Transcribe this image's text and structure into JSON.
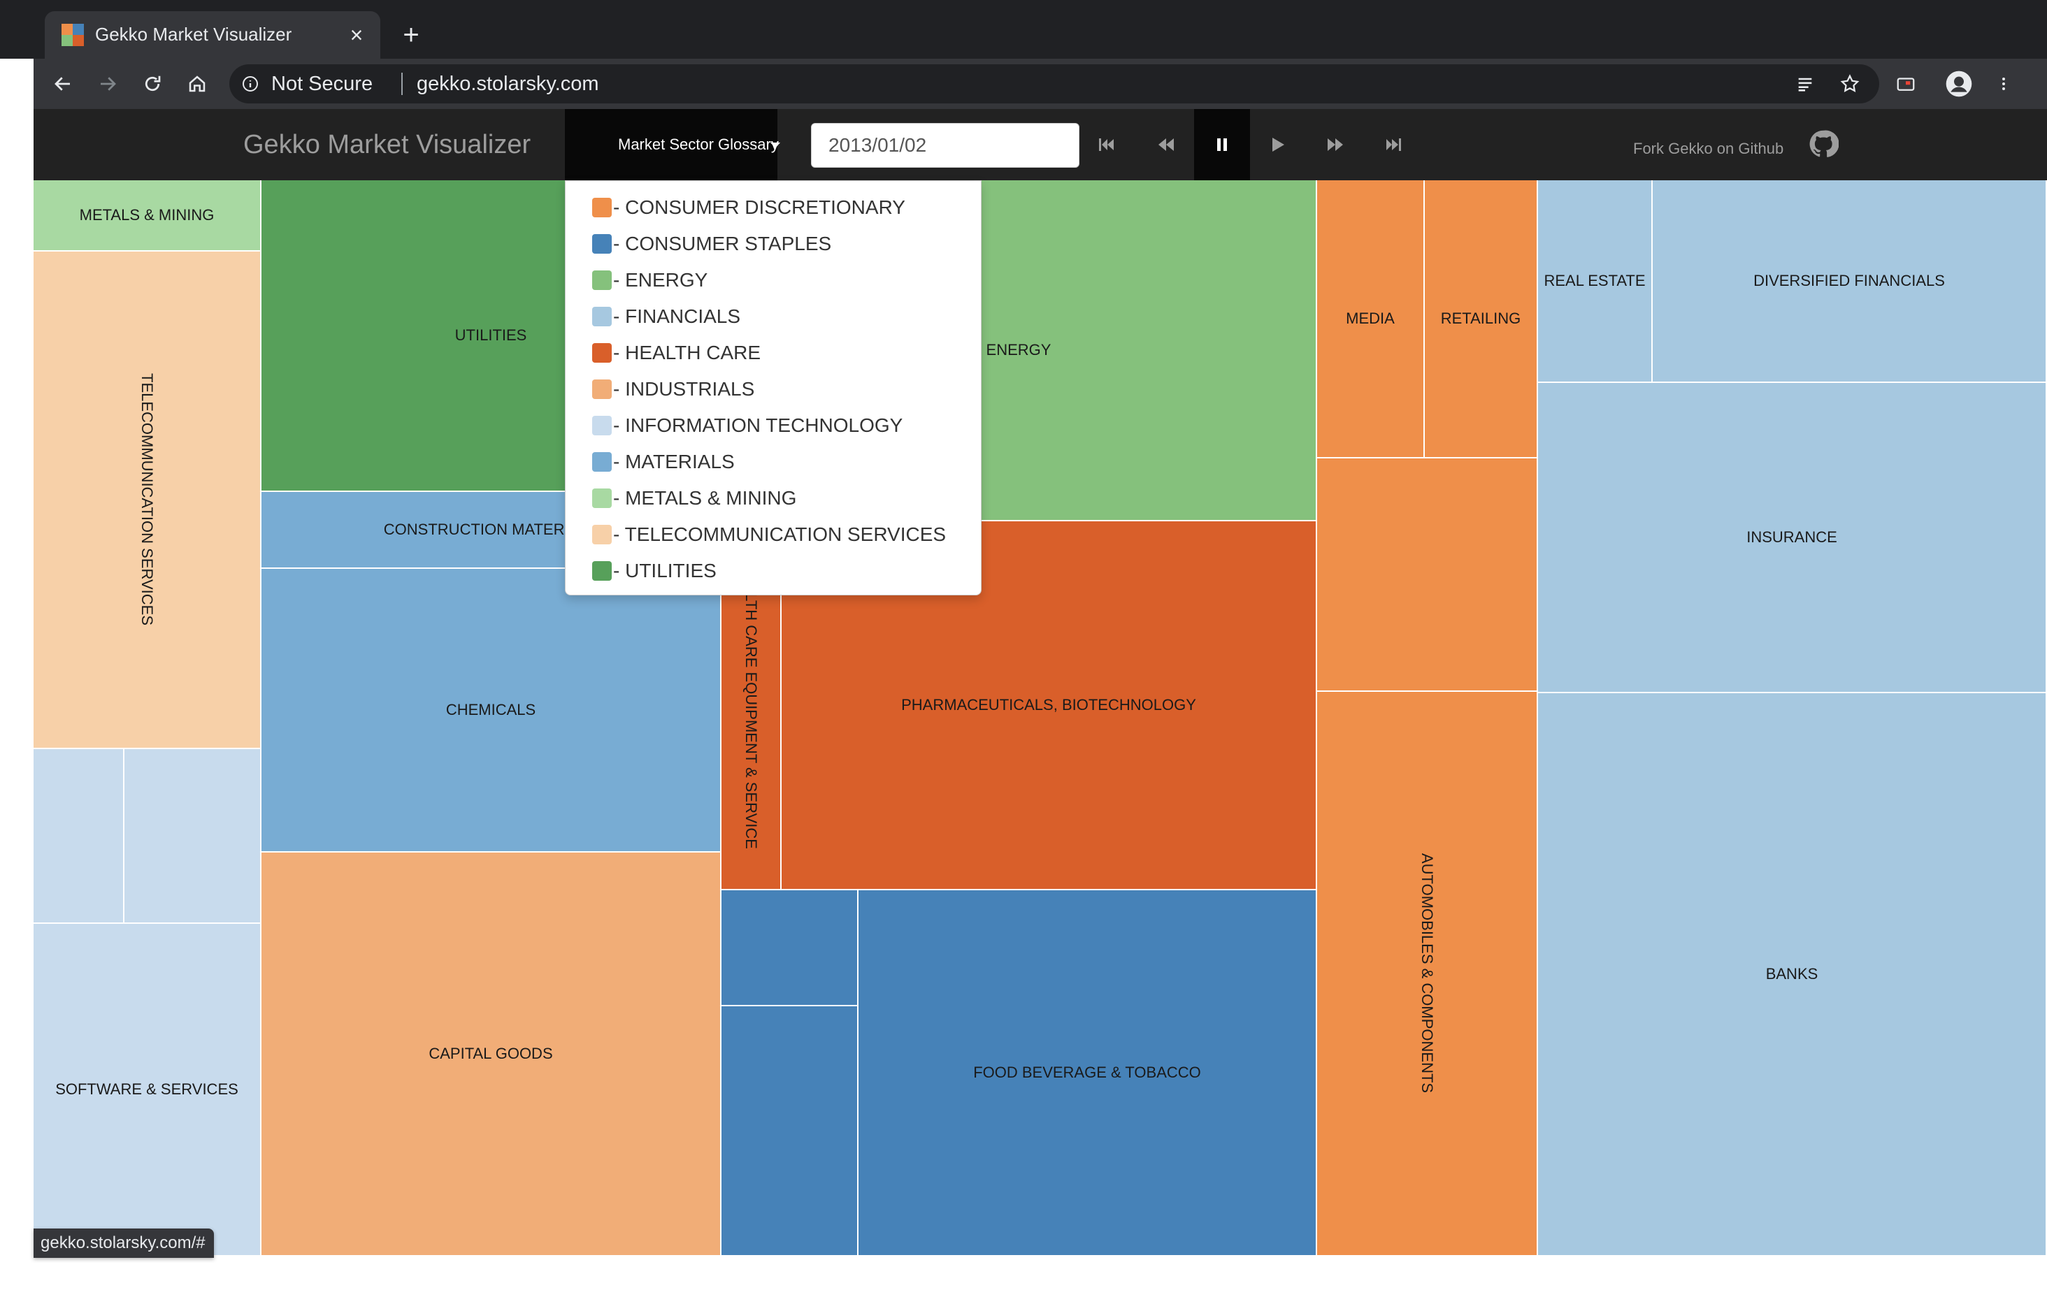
{
  "browser": {
    "tab_title": "Gekko Market Visualizer",
    "address": {
      "security_label": "Not Secure",
      "url": "gekko.stolarsky.com"
    },
    "status_url": "gekko.stolarsky.com/#"
  },
  "navbar": {
    "brand": "Gekko Market Visualizer",
    "glossary_button": "Market Sector Glossary",
    "date_value": "2013/01/02",
    "playback": [
      "jump-to-start",
      "step-back",
      "pause",
      "play",
      "step-forward",
      "jump-to-end"
    ],
    "active_control": "pause",
    "fork_link": "Fork Gekko on Github"
  },
  "glossary": [
    {
      "label": "- CONSUMER DISCRETIONARY",
      "color": "#ef8f4a"
    },
    {
      "label": "- CONSUMER STAPLES",
      "color": "#4682b8"
    },
    {
      "label": "- ENERGY",
      "color": "#85c17c"
    },
    {
      "label": "- FINANCIALS",
      "color": "#a6c8e0"
    },
    {
      "label": "- HEALTH CARE",
      "color": "#d95f2a"
    },
    {
      "label": "- INDUSTRIALS",
      "color": "#f1ad77"
    },
    {
      "label": "- INFORMATION TECHNOLOGY",
      "color": "#c8dbed"
    },
    {
      "label": "- MATERIALS",
      "color": "#78acd3"
    },
    {
      "label": "- METALS & MINING",
      "color": "#a8d9a2"
    },
    {
      "label": "- TELECOMMUNICATION SERVICES",
      "color": "#f7d0a8"
    },
    {
      "label": "- UTILITIES",
      "color": "#57a05a"
    }
  ],
  "treemap": {
    "cells": [
      {
        "id": "metals-mining",
        "label": "METALS & MINING",
        "sector": "METALS & MINING",
        "color": "#a8d9a2"
      },
      {
        "id": "telecom",
        "label": "TELECOMMUNICATION SERVICES",
        "sector": "TELECOMMUNICATION SERVICES",
        "color": "#f7d0a8"
      },
      {
        "id": "it-a",
        "label": "",
        "sector": "INFORMATION TECHNOLOGY",
        "color": "#c8dbed"
      },
      {
        "id": "it-b",
        "label": "",
        "sector": "INFORMATION TECHNOLOGY",
        "color": "#c8dbed"
      },
      {
        "id": "software",
        "label": "SOFTWARE & SERVICES",
        "sector": "INFORMATION TECHNOLOGY",
        "color": "#c8dbed"
      },
      {
        "id": "utilities",
        "label": "UTILITIES",
        "sector": "UTILITIES",
        "color": "#57a05a"
      },
      {
        "id": "construction",
        "label": "CONSTRUCTION MATERIALS",
        "sector": "MATERIALS",
        "color": "#78acd3"
      },
      {
        "id": "chemicals",
        "label": "CHEMICALS",
        "sector": "MATERIALS",
        "color": "#78acd3"
      },
      {
        "id": "capital-goods",
        "label": "CAPITAL GOODS",
        "sector": "INDUSTRIALS",
        "color": "#f1ad77"
      },
      {
        "id": "energy",
        "label": "ENERGY",
        "sector": "ENERGY",
        "color": "#85c17c"
      },
      {
        "id": "hc-equipment",
        "label": "HEALTH CARE EQUIPMENT & SERVICE",
        "sector": "HEALTH CARE",
        "color": "#d95f2a"
      },
      {
        "id": "pharma",
        "label": "PHARMACEUTICALS, BIOTECHNOLOGY",
        "sector": "HEALTH CARE",
        "color": "#d95f2a"
      },
      {
        "id": "staples-a",
        "label": "",
        "sector": "CONSUMER STAPLES",
        "color": "#4682b8"
      },
      {
        "id": "staples-b",
        "label": "",
        "sector": "CONSUMER STAPLES",
        "color": "#4682b8"
      },
      {
        "id": "food",
        "label": "FOOD BEVERAGE & TOBACCO",
        "sector": "CONSUMER STAPLES",
        "color": "#4682b8"
      },
      {
        "id": "media",
        "label": "MEDIA",
        "sector": "CONSUMER DISCRETIONARY",
        "color": "#ef8f4a"
      },
      {
        "id": "retailing",
        "label": "RETAILING",
        "sector": "CONSUMER DISCRETIONARY",
        "color": "#ef8f4a"
      },
      {
        "id": "cd-a",
        "label": "",
        "sector": "CONSUMER DISCRETIONARY",
        "color": "#ef8f4a"
      },
      {
        "id": "autos",
        "label": "AUTOMOBILES & COMPONENTS",
        "sector": "CONSUMER DISCRETIONARY",
        "color": "#ef8f4a"
      },
      {
        "id": "real-estate",
        "label": "REAL ESTATE",
        "sector": "FINANCIALS",
        "color": "#a6c8e0"
      },
      {
        "id": "diversified",
        "label": "DIVERSIFIED FINANCIALS",
        "sector": "FINANCIALS",
        "color": "#a6c8e0"
      },
      {
        "id": "insurance",
        "label": "INSURANCE",
        "sector": "FINANCIALS",
        "color": "#a6c8e0"
      },
      {
        "id": "banks",
        "label": "BANKS",
        "sector": "FINANCIALS",
        "color": "#a6c8e0"
      }
    ]
  }
}
